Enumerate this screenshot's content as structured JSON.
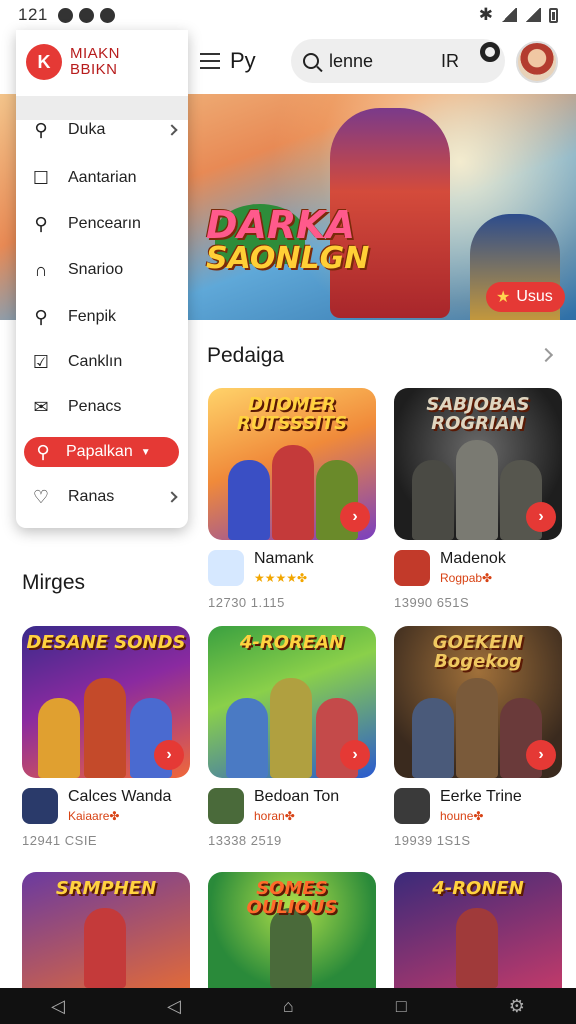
{
  "status_bar": {
    "time": "121"
  },
  "app_bar": {
    "menu_label": "Py",
    "search_value": "lenne",
    "region": "IR"
  },
  "hero": {
    "title_line1": "DARKA",
    "title_line2": "SAONLGN",
    "badge_label": "Usus"
  },
  "drawer": {
    "logo_mark": "K",
    "brand_line1": "MIAKN",
    "brand_line2": "BBIKN",
    "items": [
      {
        "label": "Duka",
        "icon": "search-icon"
      },
      {
        "label": "Aantarian",
        "icon": "square-icon"
      },
      {
        "label": "Pencearın",
        "icon": "search-icon"
      },
      {
        "label": "Snarioo",
        "icon": "building-icon"
      },
      {
        "label": "Fenpik",
        "icon": "search-icon"
      },
      {
        "label": "Canklın",
        "icon": "checkbox-icon"
      },
      {
        "label": "Penacs",
        "icon": "mail-icon"
      },
      {
        "label": "Papalkan",
        "icon": "search-icon"
      },
      {
        "label": "Ranas",
        "icon": "heart-icon"
      }
    ]
  },
  "sections": {
    "featured_title": "Pedaiga",
    "more_title": "Mirges"
  },
  "games": [
    {
      "title": "DIIOMER RUTSSSITS",
      "name": "Namank",
      "sub": "★★★★✤",
      "stat": "12730  1.115"
    },
    {
      "title": "SABJOBAS ROGRIAN",
      "name": "Madenok",
      "sub": "Rogpab✤",
      "stat": "13990  651S"
    },
    {
      "title": "DESANE SONDS",
      "name": "Calces Wanda",
      "sub": "Kaiaare✤",
      "stat": "12941  CSIE"
    },
    {
      "title": "4-ROREAN",
      "name": "Bedoan Ton",
      "sub": "horan✤",
      "stat": "13338  2519"
    },
    {
      "title": "GOEKEIN Bogekog",
      "name": "Eerke Trine",
      "sub": "houne✤",
      "stat": "19939  1S1S"
    },
    {
      "title": "SRMPHEN",
      "name": "",
      "sub": "",
      "stat": ""
    },
    {
      "title": "SOMES OULIOUS",
      "name": "",
      "sub": "",
      "stat": ""
    },
    {
      "title": "4-RONEN",
      "name": "",
      "sub": "",
      "stat": ""
    }
  ],
  "colors": {
    "accent": "#e53935",
    "drawer_bg": "#ffffff",
    "navbar": "#111111"
  }
}
